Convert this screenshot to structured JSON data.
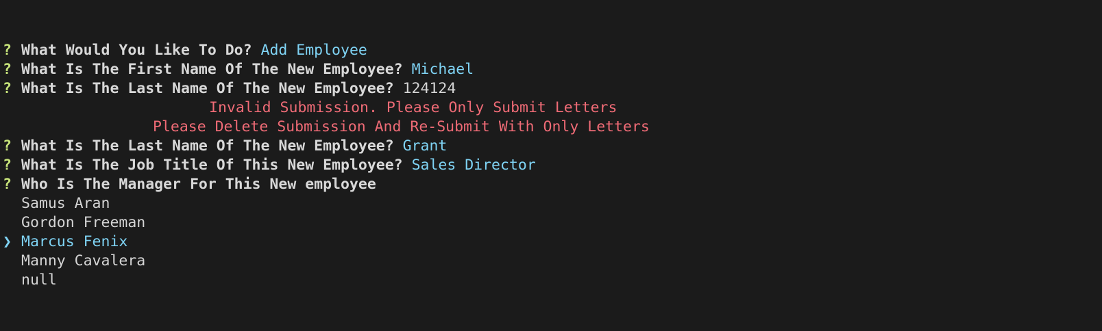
{
  "colors": {
    "background": "#1b1b1b",
    "question_mark": "#c7e47a",
    "answer": "#7fd3f4",
    "error": "#ef6b76",
    "text": "#d4d4d4"
  },
  "question_marker": "?",
  "pointer_glyph": "❯",
  "prompts": [
    {
      "question": "What Would You Like To Do?",
      "answer": "Add Employee"
    },
    {
      "question": "What Is The First Name Of The New Employee?",
      "answer": "Michael"
    },
    {
      "question": "What Is The Last Name Of The New Employee?",
      "answer": "124124"
    }
  ],
  "errors": [
    "Invalid Submission. Please Only Submit Letters",
    "Please Delete Submission And Re-Submit With Only Letters"
  ],
  "prompts_after_error": [
    {
      "question": "What Is The Last Name Of The New Employee?",
      "answer": "Grant"
    },
    {
      "question": "What Is The Job Title Of This New Employee?",
      "answer": "Sales Director"
    }
  ],
  "manager_prompt": {
    "question": "Who Is The Manager For This New employee",
    "choices": [
      "Samus Aran",
      "Gordon Freeman",
      "Marcus Fenix",
      "Manny Cavalera",
      "null"
    ],
    "selected": "Marcus Fenix"
  }
}
